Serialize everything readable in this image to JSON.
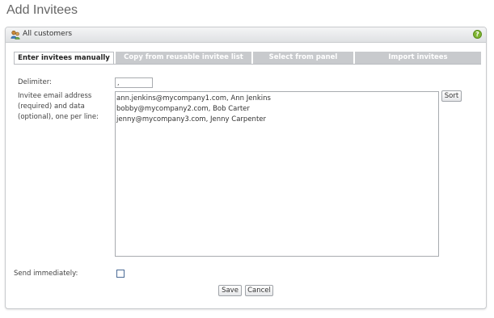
{
  "page_title": "Add Invitees",
  "panel": {
    "title": "All customers",
    "help_icon": "help-icon",
    "header_icon": "users-icon"
  },
  "tabs": [
    {
      "label": "Enter invitees manually",
      "active": true
    },
    {
      "label": "Copy from reusable invitee list",
      "active": false
    },
    {
      "label": "Select from panel",
      "active": false
    },
    {
      "label": "Import invitees",
      "active": false
    }
  ],
  "form": {
    "delimiter_label": "Delimiter:",
    "delimiter_value": ",",
    "emails_label_line1": "Invitee email address",
    "emails_label_line2": "(required) and data",
    "emails_label_line3": "(optional), one per line:",
    "emails_value": "ann.jenkins@mycompany1.com, Ann Jenkins\nbobby@mycompany2.com, Bob Carter\njenny@mycompany3.com, Jenny Carpenter",
    "sort_label": "Sort",
    "send_immediately_label": "Send immediately:",
    "send_immediately_checked": false
  },
  "actions": {
    "save_label": "Save",
    "cancel_label": "Cancel"
  },
  "colors": {
    "tab_inactive": "#c8cacd",
    "help_green": "#7fb531",
    "panel_border": "#c9cbce"
  }
}
